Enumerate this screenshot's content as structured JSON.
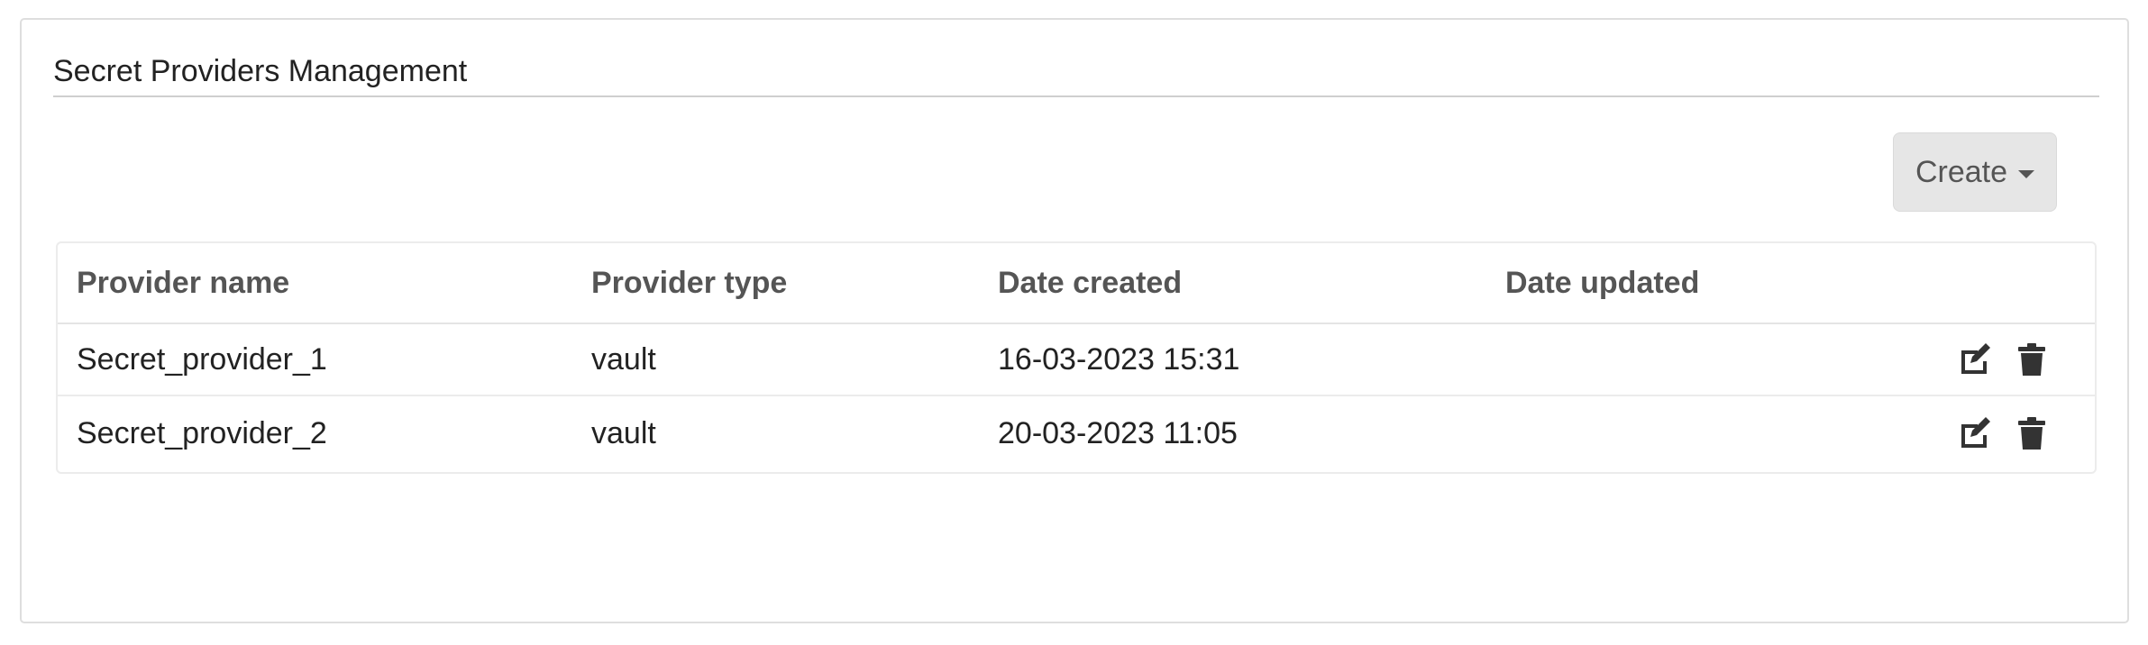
{
  "panel": {
    "title": "Secret Providers Management"
  },
  "toolbar": {
    "create_label": "Create",
    "create_icon": "caret-down-icon"
  },
  "table": {
    "columns": [
      "Provider name",
      "Provider type",
      "Date created",
      "Date updated"
    ],
    "rows": [
      {
        "name": "Secret_provider_1",
        "type": "vault",
        "created": "16-03-2023 15:31",
        "updated": "",
        "actions": [
          "edit-icon",
          "trash-icon"
        ]
      },
      {
        "name": "Secret_provider_2",
        "type": "vault",
        "created": "20-03-2023 11:05",
        "updated": "",
        "actions": [
          "edit-icon",
          "trash-icon"
        ]
      }
    ]
  },
  "colors": {
    "icon": "#333333",
    "create_button_bg": "#e6e6e6",
    "header_text": "#555555"
  }
}
